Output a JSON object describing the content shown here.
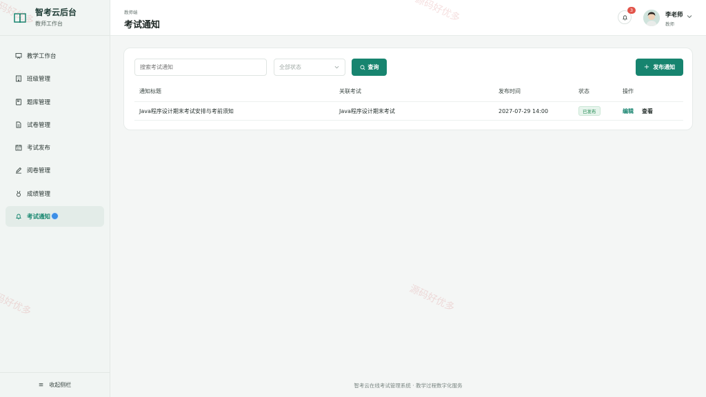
{
  "brand": {
    "title": "智考云后台",
    "subtitle": "教师工作台"
  },
  "sidebar": {
    "items": [
      {
        "label": "教学工作台",
        "icon": "chalkboard-icon",
        "active": false
      },
      {
        "label": "班级管理",
        "icon": "building-icon",
        "active": false
      },
      {
        "label": "题库管理",
        "icon": "question-bank-icon",
        "active": false
      },
      {
        "label": "试卷管理",
        "icon": "document-icon",
        "active": false
      },
      {
        "label": "考试发布",
        "icon": "calendar-icon",
        "active": false
      },
      {
        "label": "阅卷管理",
        "icon": "pen-icon",
        "active": false
      },
      {
        "label": "成绩管理",
        "icon": "medal-icon",
        "active": false
      },
      {
        "label": "考试通知",
        "icon": "bell-icon",
        "active": true
      }
    ],
    "collapse_label": "收起侧栏"
  },
  "header": {
    "breadcrumb": "教师端",
    "title": "考试通知",
    "notification_count": "3",
    "user_name": "李老师",
    "user_role": "教师"
  },
  "toolbar": {
    "search_placeholder": "搜索考试通知",
    "status_select": "全部状态",
    "query_label": "查询",
    "publish_label": "发布通知"
  },
  "table": {
    "columns": [
      "通知标题",
      "关联考试",
      "发布时间",
      "状态",
      "操作"
    ],
    "rows": [
      {
        "title": "Java程序设计期末考试安排与考前须知",
        "exam": "Java程序设计期末考试",
        "time": "2027-07-29 14:00",
        "status": "已发布",
        "actions": [
          "编辑",
          "查看"
        ]
      }
    ]
  },
  "footer": "智考云在线考试管理系统 · 教学过程数字化服务",
  "watermark": "源码好优多",
  "colors": {
    "accent": "#17846f",
    "badge": "#e2544a",
    "published": "#228a52"
  }
}
